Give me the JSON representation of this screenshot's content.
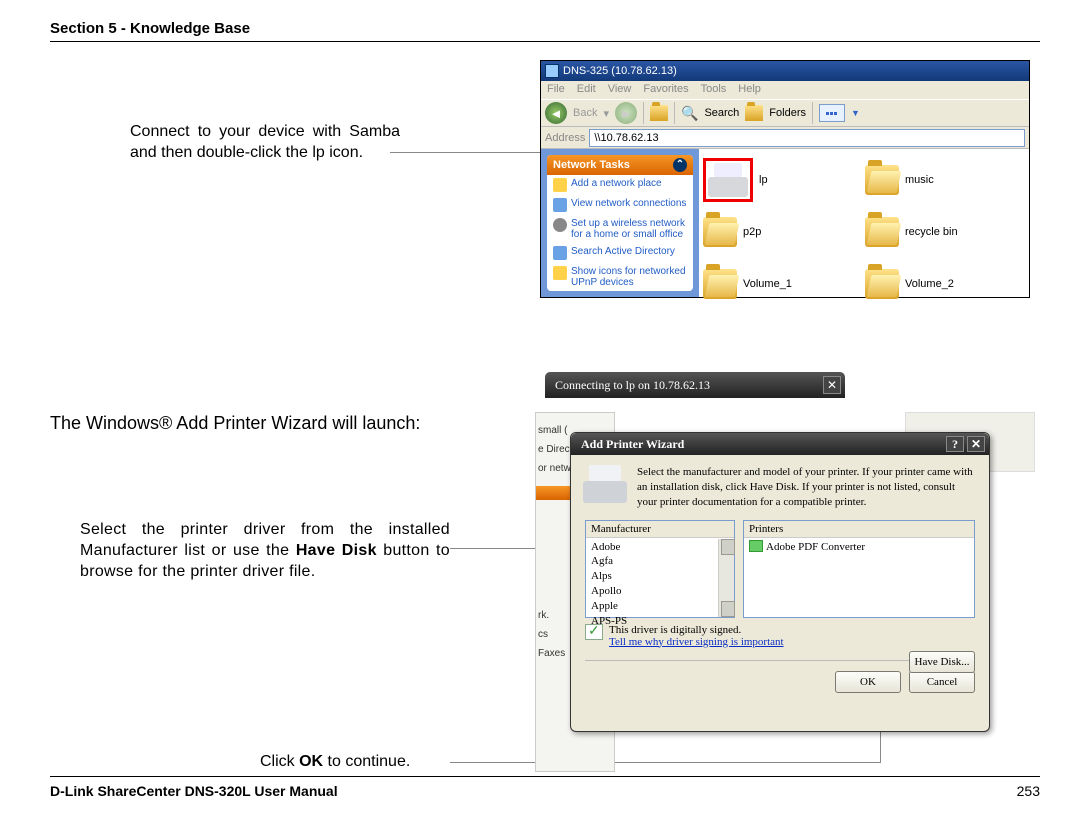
{
  "header": {
    "section": "Section 5 - Knowledge Base"
  },
  "footer": {
    "manual": "D-Link ShareCenter DNS-320L User Manual",
    "page": "253"
  },
  "instr": {
    "connect": "Connect to your device with Samba and then double-click the lp icon.",
    "launch": "The Windows® Add Printer Wizard will launch:",
    "driver_a": "Select the printer driver from the installed Manufacturer list or use the ",
    "driver_bold": "Have Disk",
    "driver_b": " button to browse for the printer driver file.",
    "ok_a": "Click ",
    "ok_bold": "OK",
    "ok_b": " to continue."
  },
  "explorer": {
    "title": "DNS-325 (10.78.62.13)",
    "menus": [
      "File",
      "Edit",
      "View",
      "Favorites",
      "Tools",
      "Help"
    ],
    "back": "Back",
    "search": "Search",
    "folders": "Folders",
    "address_label": "Address",
    "address_value": "\\\\10.78.62.13",
    "task_title": "Network Tasks",
    "tasks": [
      "Add a network place",
      "View network connections",
      "Set up a wireless network for a home or small office",
      "Search Active Directory",
      "Show icons for networked UPnP devices"
    ],
    "files": [
      "lp",
      "music",
      "p2p",
      "recycle bin",
      "Volume_1",
      "Volume_2"
    ]
  },
  "connecting": {
    "text": "Connecting to lp on 10.78.62.13"
  },
  "wizard": {
    "title": "Add Printer Wizard",
    "desc": "Select the manufacturer and model of your printer. If your printer came with an installation disk, click Have Disk. If your printer is not listed, consult your printer documentation for a compatible printer.",
    "manuf_label": "Manufacturer",
    "printers_label": "Printers",
    "manufacturers": [
      "Adobe",
      "Agfa",
      "Alps",
      "Apollo",
      "Apple",
      "APS-PS"
    ],
    "printer_item": "Adobe PDF Converter",
    "signed": "This driver is digitally signed.",
    "signed_link": "Tell me why driver signing is important",
    "have_disk": "Have Disk...",
    "ok": "OK",
    "cancel": "Cancel"
  },
  "behind": {
    "items": [
      "small (",
      "e Direct",
      "or netw",
      "rk.",
      "cs",
      "Faxes"
    ]
  }
}
